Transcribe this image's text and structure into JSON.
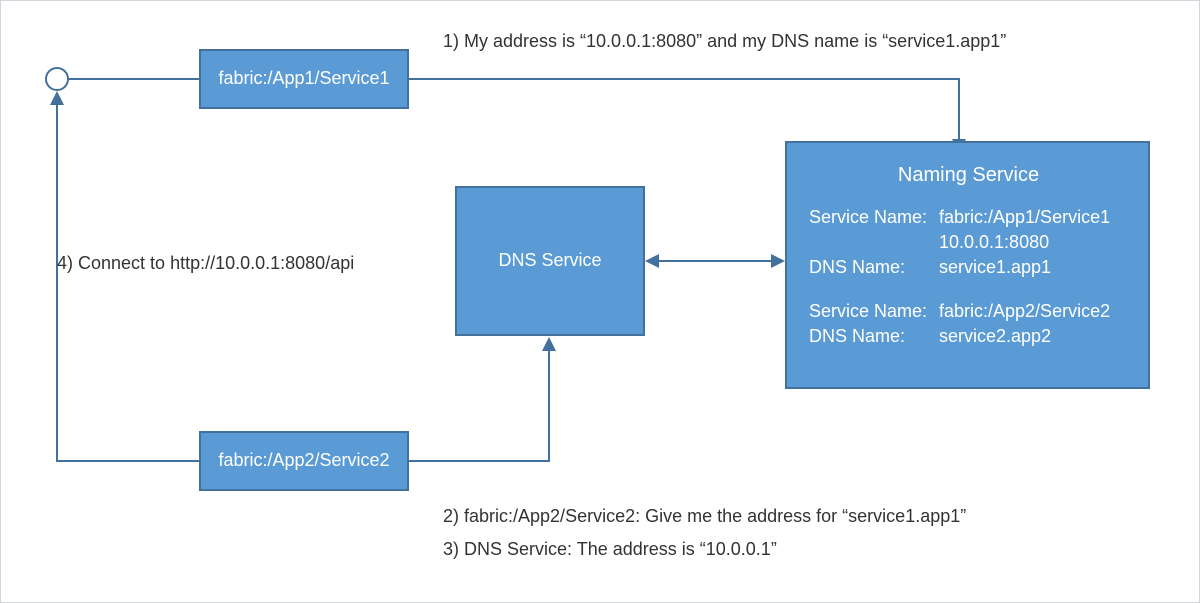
{
  "boxes": {
    "service1": {
      "label": "fabric:/App1/Service1"
    },
    "service2": {
      "label": "fabric:/App2/Service2"
    },
    "dns": {
      "label": "DNS Service"
    },
    "naming": {
      "title": "Naming Service",
      "rows": [
        {
          "label": "Service Name:",
          "value": "fabric:/App1/Service1"
        },
        {
          "label": "",
          "value": "10.0.0.1:8080"
        },
        {
          "label": "DNS Name:",
          "value": "service1.app1"
        }
      ],
      "rows2": [
        {
          "label": "Service Name:",
          "value": "fabric:/App2/Service2"
        },
        {
          "label": "DNS Name:",
          "value": "service2.app2"
        }
      ]
    }
  },
  "annotations": {
    "step1": "1) My address is “10.0.0.1:8080” and my DNS name is “service1.app1”",
    "step2": "2) fabric:/App2/Service2: Give me the address for “service1.app1”",
    "step3": "3) DNS Service: The address is “10.0.0.1”",
    "step4": "4) Connect to http://10.0.0.1:8080/api"
  },
  "colors": {
    "box_fill": "#5b9bd5",
    "box_border": "#41719c",
    "text_dark": "#333333"
  }
}
